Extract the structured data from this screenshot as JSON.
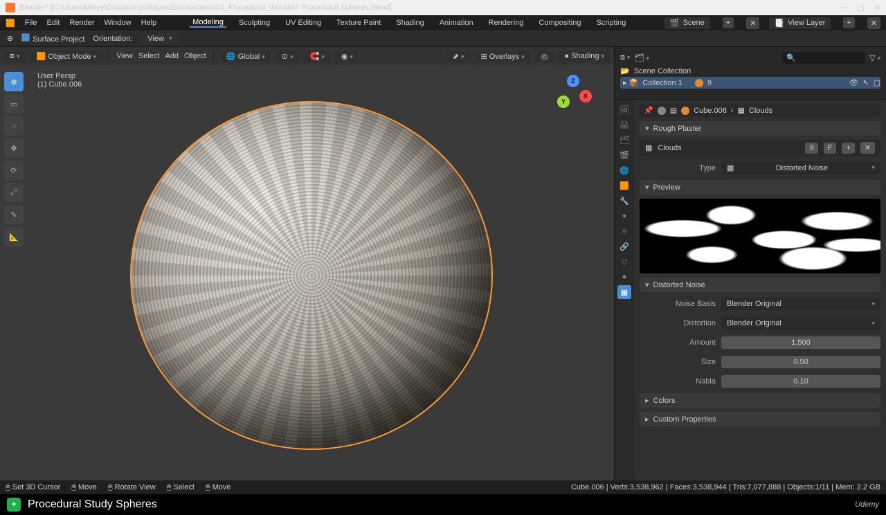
{
  "title": "Blender* [C:\\Users\\Mikey\\Documents\\Repos\\Environments\\3_Procedural_Worlds\\7 Procedural Spheres.blend]",
  "wm": {
    "min": "—",
    "max": "▢",
    "close": "✕"
  },
  "menu": {
    "file": "File",
    "edit": "Edit",
    "render": "Render",
    "window": "Window",
    "help": "Help"
  },
  "workspaces": {
    "modeling": "Modeling",
    "sculpting": "Sculpting",
    "uv": "UV Editing",
    "texpaint": "Texture Paint",
    "shading": "Shading",
    "anim": "Animation",
    "render": "Rendering",
    "comp": "Compositing",
    "script": "Scripting"
  },
  "scene_label": "Scene",
  "viewlayer": "View Layer",
  "workbar": {
    "surface": "Surface Project",
    "orient": "Orientation:",
    "view": "View"
  },
  "vp": {
    "mode": "Object Mode",
    "view": "View",
    "select": "Select",
    "add": "Add",
    "object": "Object",
    "global": "Global",
    "overlays": "Overlays",
    "shading": "Shading"
  },
  "overlay": {
    "persp": "User Persp",
    "obj": "(1) Cube.006"
  },
  "gizmo": {
    "x": "X",
    "y": "Y",
    "z": "Z"
  },
  "outliner": {
    "scene": "Scene Collection",
    "collection": "Collection 1",
    "count": "9"
  },
  "crumb": {
    "obj": "Cube.006",
    "tex": "Clouds"
  },
  "panels": {
    "rough": "Rough Plaster",
    "texname": "Clouds",
    "texnum": "9",
    "texF": "F",
    "type_lab": "Type",
    "type_val": "Distorted Noise",
    "preview": "Preview",
    "dist": "Distorted Noise",
    "basis_lab": "Noise Basis",
    "basis_val": "Blender Original",
    "distortion_lab": "Distortion",
    "distortion_val": "Blender Original",
    "amount_lab": "Amount",
    "amount_val": "1.500",
    "size_lab": "Size",
    "size_val": "0.50",
    "nabla_lab": "Nabla",
    "nabla_val": "0.10",
    "colors": "Colors",
    "custom": "Custom Properties"
  },
  "status": {
    "cursor": "Set 3D Cursor",
    "move1": "Move",
    "rotate": "Rotate View",
    "select": "Select",
    "move2": "Move",
    "stats": "Cube.006 | Verts:3,538,962 | Faces:3,538,944 | Tris:7,077,888 | Objects:1/11 | Mem: 2.2 GB"
  },
  "bottom": {
    "title": "Procedural Study Spheres",
    "brand": "Udemy"
  }
}
